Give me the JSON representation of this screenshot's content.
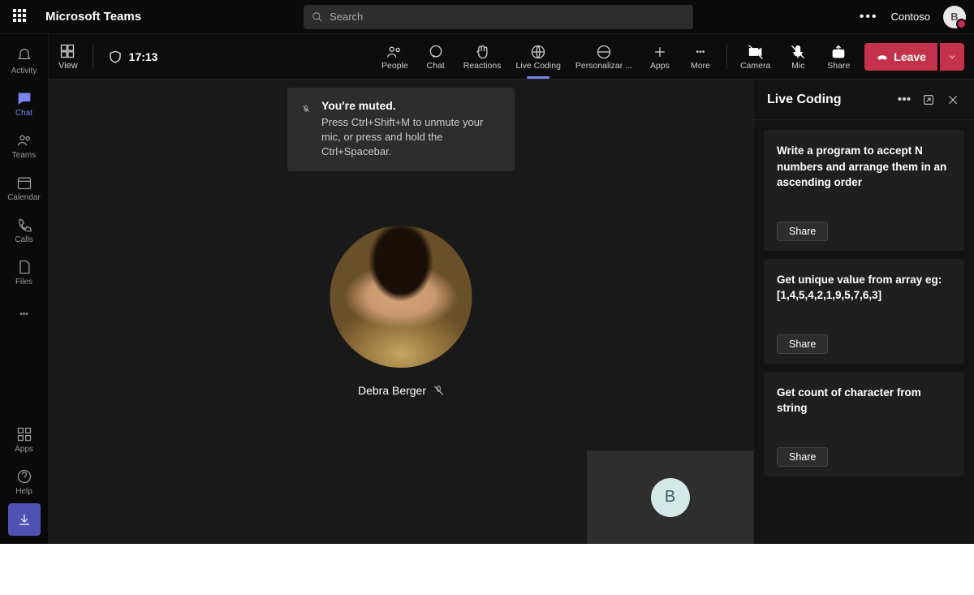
{
  "header": {
    "app_title": "Microsoft Teams",
    "search_placeholder": "Search",
    "tenant": "Contoso",
    "avatar_initial": "B"
  },
  "sidebar": {
    "items": [
      {
        "label": "Activity",
        "icon": "bell-icon"
      },
      {
        "label": "Chat",
        "icon": "chat-icon"
      },
      {
        "label": "Teams",
        "icon": "teams-icon"
      },
      {
        "label": "Calendar",
        "icon": "calendar-icon"
      },
      {
        "label": "Calls",
        "icon": "calls-icon"
      },
      {
        "label": "Files",
        "icon": "files-icon"
      }
    ],
    "more_label": "",
    "apps_label": "Apps",
    "help_label": "Help"
  },
  "meeting_bar": {
    "view_label": "View",
    "timer": "17:13",
    "buttons": {
      "people": "People",
      "chat": "Chat",
      "reactions": "Reactions",
      "live_coding": "Live Coding",
      "personalizar": "Personalizar ...",
      "apps": "Apps",
      "more": "More",
      "camera": "Camera",
      "mic": "Mic",
      "share": "Share"
    },
    "leave_label": "Leave"
  },
  "stage": {
    "muted_title": "You're muted.",
    "muted_sub": "Press Ctrl+Shift+M to unmute your mic, or press and hold the Ctrl+Spacebar.",
    "participant_name": "Debra Berger",
    "self_initial": "B"
  },
  "right_panel": {
    "title": "Live Coding",
    "cards": [
      {
        "text": "Write a program to accept N numbers and arrange them in an ascending order",
        "button": "Share"
      },
      {
        "text": "Get unique value from array eg:[1,4,5,4,2,1,9,5,7,6,3]",
        "button": "Share"
      },
      {
        "text": "Get count of character from string",
        "button": "Share"
      }
    ]
  }
}
